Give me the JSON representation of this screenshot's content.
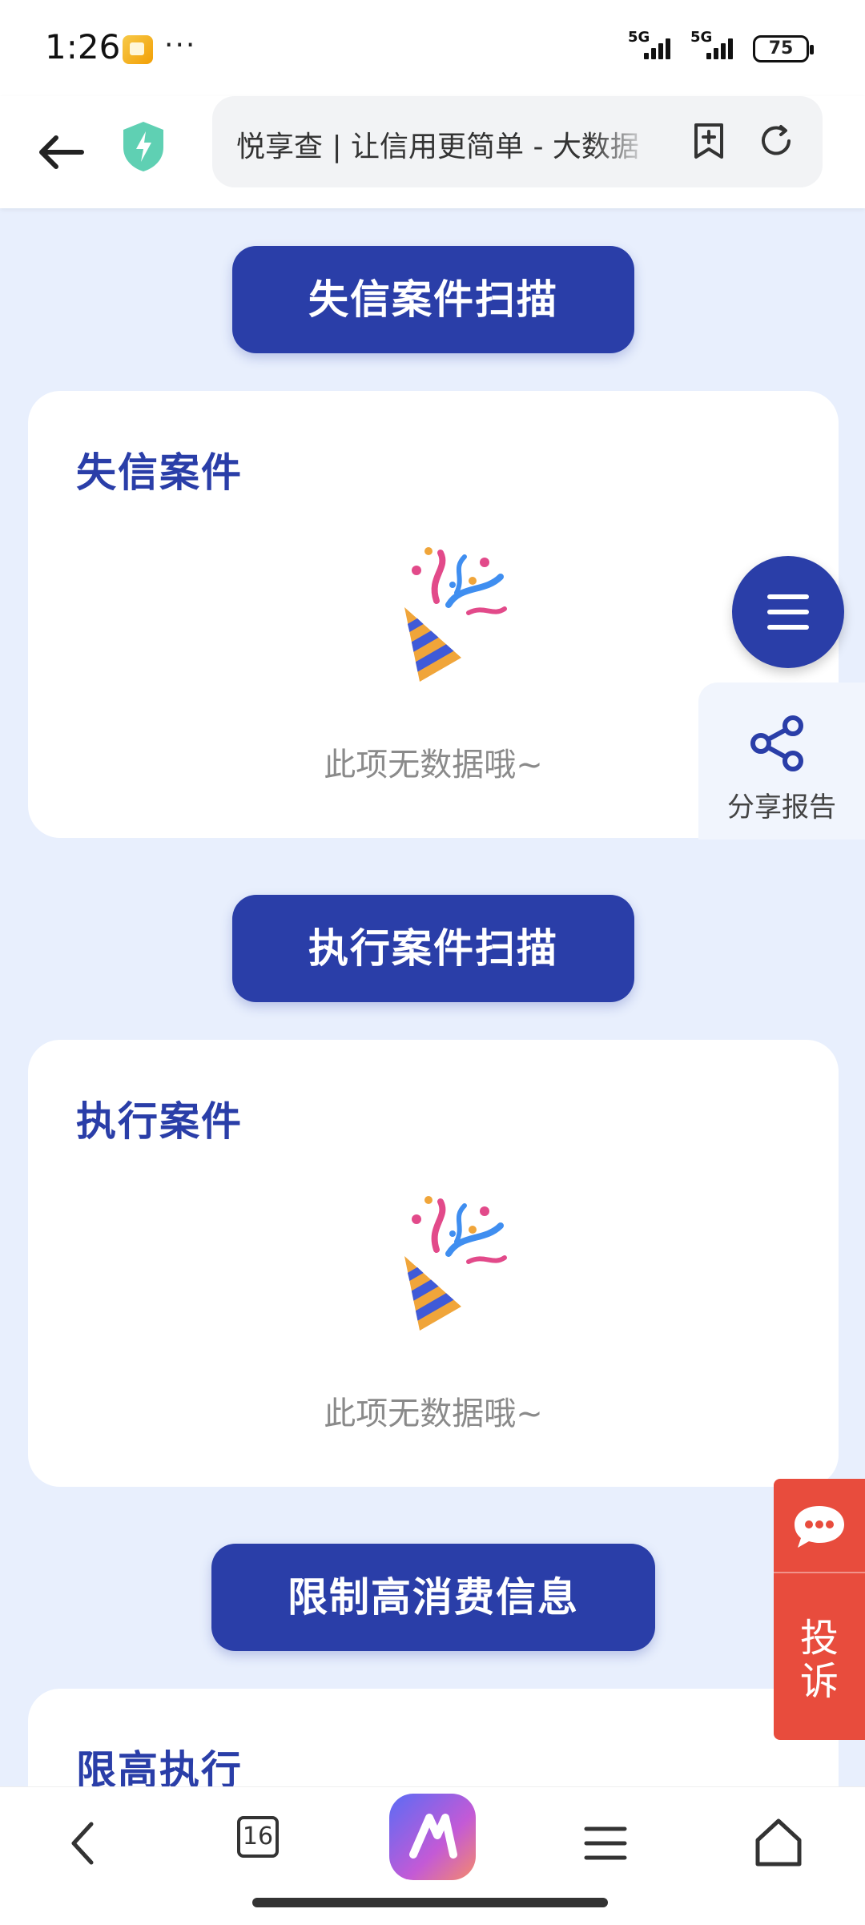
{
  "status_bar": {
    "time": "1:26",
    "more": "···",
    "network_1": "5G",
    "network_2": "5G",
    "battery": "75"
  },
  "browser": {
    "page_title": "悦享查 | 让信用更简单 - 大数据",
    "tab_count": "16"
  },
  "sections": [
    {
      "scan_button": "失信案件扫描",
      "card_title": "失信案件",
      "empty_text": "此项无数据哦~"
    },
    {
      "scan_button": "执行案件扫描",
      "card_title": "执行案件",
      "empty_text": "此项无数据哦~"
    },
    {
      "scan_button": "限制高消费信息",
      "card_title": "限高执行"
    }
  ],
  "floating": {
    "share_label": "分享报告",
    "complaint_label": "投诉"
  },
  "icons": {
    "back": "arrow-left",
    "security": "shield-bolt",
    "bookmark": "bookmark-plus",
    "reload": "refresh",
    "menu": "hamburger",
    "share": "share-nodes",
    "chat": "chat-bubble",
    "party": "party-popper",
    "nav_back": "chevron-left",
    "nav_menu": "menu-lines",
    "nav_home": "home"
  },
  "colors": {
    "primary": "#2a3ea8",
    "page_bg": "#e8effd",
    "complaint_tab": "#e84c3d",
    "empty_text": "#8a8a8a"
  }
}
